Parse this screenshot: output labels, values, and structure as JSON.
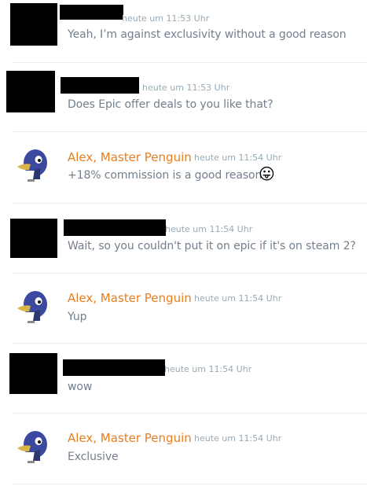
{
  "messages": [
    {
      "author": "",
      "redacted": true,
      "timestamp": "heute um 11:53 Uhr",
      "text": "Yeah, I’m against exclusivity without a good reason"
    },
    {
      "author": "",
      "redacted": true,
      "timestamp": "heute um 11:53 Uhr",
      "text": "Does Epic offer deals to you like that?"
    },
    {
      "author": "Alex, Master Penguin",
      "redacted": false,
      "timestamp": "heute um 11:54 Uhr",
      "text": "+18% commission is a good reason",
      "emoji": "😛"
    },
    {
      "author": "",
      "redacted": true,
      "timestamp": "heute um 11:54 Uhr",
      "text": "Wait, so you couldn't put it on epic if it's on steam 2?"
    },
    {
      "author": "Alex, Master Penguin",
      "redacted": false,
      "timestamp": "heute um 11:54 Uhr",
      "text": "Yup"
    },
    {
      "author": "",
      "redacted": true,
      "timestamp": "heute um 11:54 Uhr",
      "text": "wow"
    },
    {
      "author": "Alex, Master Penguin",
      "redacted": false,
      "timestamp": "heute um 11:54 Uhr",
      "text": "Exclusive"
    }
  ],
  "colors": {
    "author_name": "#e67e22",
    "message_text": "#737f8d",
    "timestamp": "#99aab5",
    "divider": "#ececec",
    "redaction": "#000000"
  },
  "icons": {
    "penguin_avatar": "penguin-avatar-icon",
    "emoji": "tongue-out-emoji-icon"
  }
}
